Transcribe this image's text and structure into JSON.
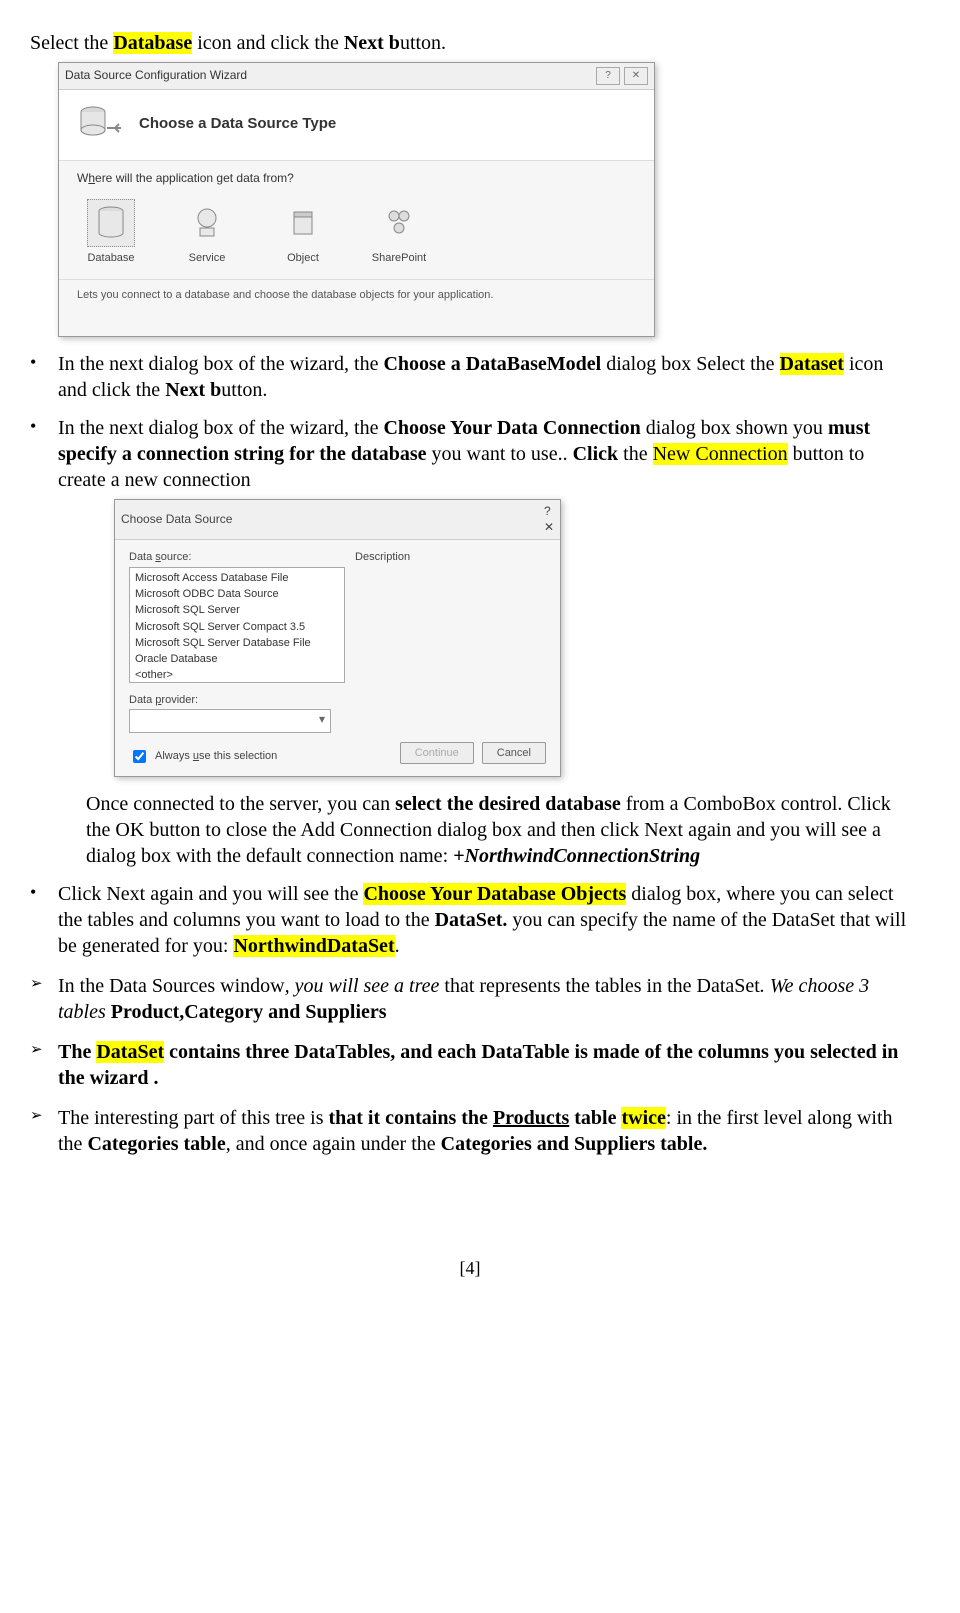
{
  "para0": {
    "a": "Select the ",
    "db": "Database",
    "b": " icon and click the ",
    "next": "Next b",
    "c": "utton."
  },
  "dlg1": {
    "title": "Data Source Configuration Wizard",
    "header": "Choose a Data Source Type",
    "prompt_pre": "W",
    "prompt_u": "h",
    "prompt_post": "ere will the application get data from?",
    "opts": [
      "Database",
      "Service",
      "Object",
      "SharePoint"
    ],
    "desc": "Lets you connect to a database and choose the database objects for your application."
  },
  "bullet1": {
    "a": "In the next dialog box of the wizard, the ",
    "b": "Choose a DataBaseModel",
    "c": " dialog box Select the ",
    "d": "Dataset",
    "e": " icon and click the ",
    "f": "Next b",
    "g": "utton."
  },
  "bullet2": {
    "a": "In the next dialog box of the wizard, the ",
    "b": "Choose Your Data Connection",
    "c": " dialog box shown you ",
    "d": "must specify a connection string for the database",
    "e": " you want to use.. ",
    "f": "Click",
    "g": " the ",
    "h": "New Connection",
    "i": " button to create a new connection"
  },
  "dlg2": {
    "title": "Choose Data Source",
    "sources_label_a": "Data ",
    "sources_label_u": "s",
    "sources_label_b": "ource:",
    "desc_label": "Description",
    "list": [
      "Microsoft Access Database File",
      "Microsoft ODBC Data Source",
      "Microsoft SQL Server",
      "Microsoft SQL Server Compact 3.5",
      "Microsoft SQL Server Database File",
      "Oracle Database",
      "<other>"
    ],
    "provider_label_a": "Data ",
    "provider_label_u": "p",
    "provider_label_b": "rovider:",
    "always_a": "Always ",
    "always_u": "u",
    "always_b": "se this selection",
    "continue": "Continue",
    "cancel": "Cancel"
  },
  "para_after_dlg2": {
    "a": "Once connected to the server, you can ",
    "b": "select the desired database",
    "c": " from a ComboBox control. Click the OK button to close the Add Connection dialog box and then click Next again and you will see a dialog box with the default connection name: ",
    "d": "+NorthwindConnectionString"
  },
  "bullet3": {
    "a": "Click Next again and you will see the ",
    "b": "Choose Your Database Objects",
    "c": " dialog box, where you can select the tables and columns you want to load to the ",
    "d": "DataSet.",
    "e": " you can specify the name of the DataSet that will be generated for you: ",
    "f": "NorthwindDataSet",
    "g": "."
  },
  "arrow1": {
    "a": "In the Data Sources window",
    "b": ", you will see a tree",
    "c": " that represents the tables in the DataSet",
    "d": ". We choose ",
    "e": "3 tables",
    "f": " ",
    "g": "Product,Category and Suppliers"
  },
  "arrow2": {
    "a": "The ",
    "b": "DataSet",
    "c": " contains three DataTables, and each DataTable is made of the columns you selected in the wizard ."
  },
  "arrow3": {
    "a": "The interesting part of this tree is ",
    "b": "that it contains the ",
    "c": "Products",
    "d": " table ",
    "e": "twice",
    "f": ": in the first level along with the ",
    "g": "Categories table",
    "h": ", and once again under the ",
    "i": "Categories and Suppliers table."
  },
  "page_num": "[4]"
}
